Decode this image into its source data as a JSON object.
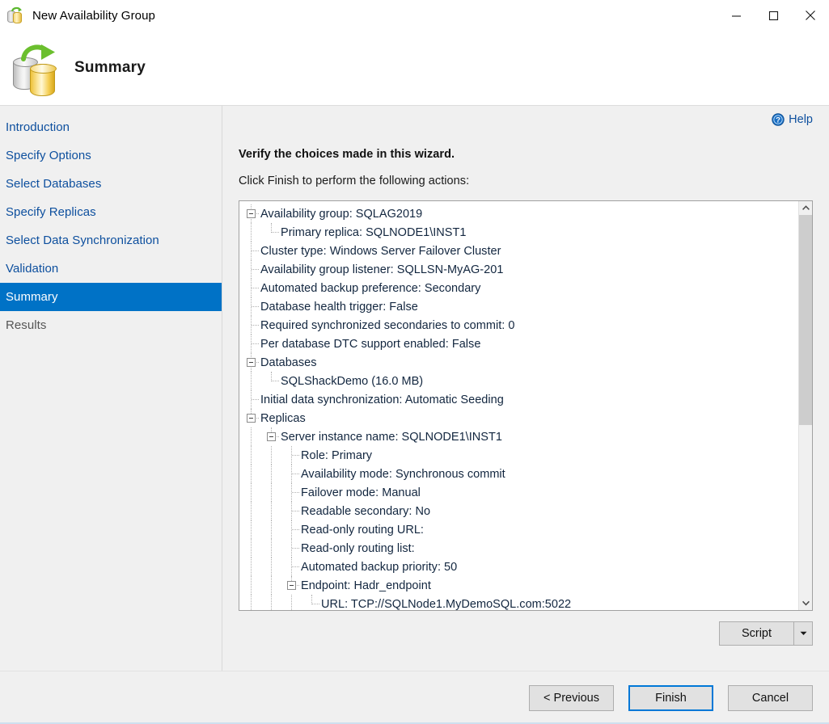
{
  "window": {
    "title": "New Availability Group",
    "icon": "availability-group-icon",
    "controls": {
      "minimize": "minimize-icon",
      "maximize": "maximize-icon",
      "close": "close-icon"
    }
  },
  "header": {
    "title": "Summary",
    "icon": "availability-group-large-icon"
  },
  "sidebar": {
    "items": [
      {
        "label": "Introduction",
        "state": "normal"
      },
      {
        "label": "Specify Options",
        "state": "normal"
      },
      {
        "label": "Select Databases",
        "state": "normal"
      },
      {
        "label": "Specify Replicas",
        "state": "normal"
      },
      {
        "label": "Select Data Synchronization",
        "state": "normal"
      },
      {
        "label": "Validation",
        "state": "normal"
      },
      {
        "label": "Summary",
        "state": "selected"
      },
      {
        "label": "Results",
        "state": "disabled"
      }
    ]
  },
  "content": {
    "help_label": "Help",
    "verify_heading": "Verify the choices made in this wizard.",
    "instruction": "Click Finish to perform the following actions:",
    "tree": [
      {
        "depth": 0,
        "expander": true,
        "label": "Availability group: SQLAG2019"
      },
      {
        "depth": 1,
        "expander": false,
        "label": "Primary replica: SQLNODE1\\INST1"
      },
      {
        "depth": 0,
        "expander": false,
        "label": "Cluster type: Windows Server Failover Cluster"
      },
      {
        "depth": 0,
        "expander": false,
        "label": "Availability group listener: SQLLSN-MyAG-201"
      },
      {
        "depth": 0,
        "expander": false,
        "label": "Automated backup preference: Secondary"
      },
      {
        "depth": 0,
        "expander": false,
        "label": "Database health trigger: False"
      },
      {
        "depth": 0,
        "expander": false,
        "label": "Required synchronized secondaries to commit: 0"
      },
      {
        "depth": 0,
        "expander": false,
        "label": "Per database DTC support enabled: False"
      },
      {
        "depth": 0,
        "expander": true,
        "label": "Databases"
      },
      {
        "depth": 1,
        "expander": false,
        "label": "SQLShackDemo (16.0 MB)"
      },
      {
        "depth": 0,
        "expander": false,
        "label": "Initial data synchronization: Automatic Seeding"
      },
      {
        "depth": 0,
        "expander": true,
        "label": "Replicas"
      },
      {
        "depth": 1,
        "expander": true,
        "label": "Server instance name: SQLNODE1\\INST1"
      },
      {
        "depth": 2,
        "expander": false,
        "label": "Role: Primary"
      },
      {
        "depth": 2,
        "expander": false,
        "label": "Availability mode: Synchronous commit"
      },
      {
        "depth": 2,
        "expander": false,
        "label": "Failover mode: Manual"
      },
      {
        "depth": 2,
        "expander": false,
        "label": "Readable secondary: No"
      },
      {
        "depth": 2,
        "expander": false,
        "label": "Read-only routing URL:"
      },
      {
        "depth": 2,
        "expander": false,
        "label": "Read-only routing list:"
      },
      {
        "depth": 2,
        "expander": false,
        "label": "Automated backup priority: 50"
      },
      {
        "depth": 2,
        "expander": true,
        "label": "Endpoint: Hadr_endpoint"
      },
      {
        "depth": 3,
        "expander": false,
        "label": "URL: TCP://SQLNode1.MyDemoSQL.com:5022"
      }
    ],
    "scrollbar": {
      "thumb_fraction": 55
    }
  },
  "actions": {
    "script_label": "Script",
    "script_dropdown": "chevron-down-icon",
    "previous_label": "< Previous",
    "finish_label": "Finish",
    "cancel_label": "Cancel"
  },
  "colors": {
    "accent": "#0072c6",
    "link": "#0d4f9e",
    "focus_border": "#0078d7",
    "window_bg": "#f0f0f0"
  }
}
